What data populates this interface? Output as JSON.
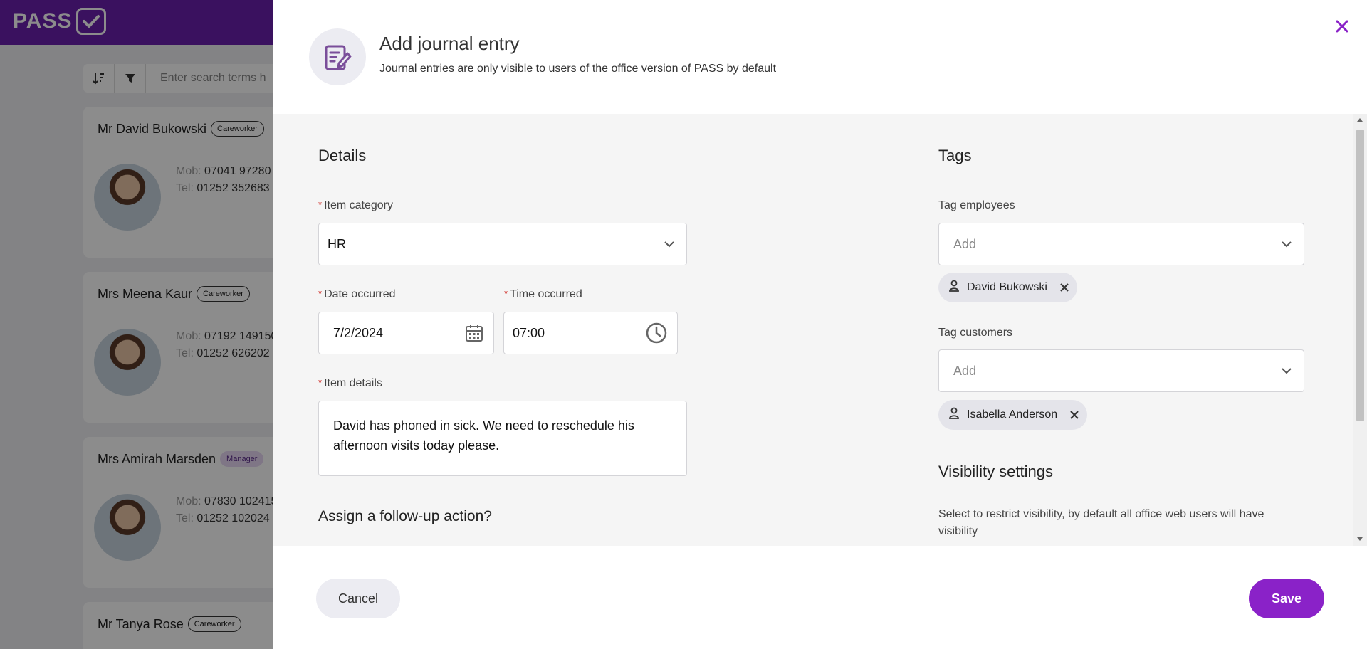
{
  "background": {
    "logo_text": "PASS",
    "search_placeholder": "Enter search terms h",
    "cards": [
      {
        "name": "Mr David Bukowski",
        "badge": "Careworker",
        "mob_label": "Mob:",
        "mob": "07041 97280",
        "tel_label": "Tel:",
        "tel": "01252 352683"
      },
      {
        "name": "Mrs Meena Kaur",
        "badge": "Careworker",
        "mob_label": "Mob:",
        "mob": "07192 149150",
        "tel_label": "Tel:",
        "tel": "01252 626202"
      },
      {
        "name": "Mrs Amirah Marsden",
        "badge": "Manager",
        "mob_label": "Mob:",
        "mob": "07830 102415",
        "tel_label": "Tel:",
        "tel": "01252 102024"
      },
      {
        "name": "Mr Tanya Rose",
        "badge": "Careworker"
      }
    ]
  },
  "drawer": {
    "title": "Add journal entry",
    "subtitle": "Journal entries are only visible to users of the office version of PASS by default",
    "details": {
      "heading": "Details",
      "item_category_label": "Item category",
      "item_category_value": "HR",
      "date_label": "Date occurred",
      "date_value": "7/2/2024",
      "time_label": "Time occurred",
      "time_value": "07:00",
      "item_details_label": "Item details",
      "item_details_value": "David has phoned in sick. We need to reschedule his afternoon visits today please.",
      "follow_up_heading": "Assign a follow-up action?"
    },
    "tags": {
      "heading": "Tags",
      "employees_label": "Tag employees",
      "employees_placeholder": "Add",
      "employee_chip": "David Bukowski",
      "customers_label": "Tag customers",
      "customers_placeholder": "Add",
      "customer_chip": "Isabella Anderson"
    },
    "visibility": {
      "heading": "Visibility settings",
      "text": "Select to restrict visibility, by default all office web users will have visibility"
    },
    "footer": {
      "cancel_label": "Cancel",
      "save_label": "Save"
    },
    "colors": {
      "brand": "#6a1fae",
      "accent": "#8a22c8",
      "required": "#d0302a"
    }
  }
}
